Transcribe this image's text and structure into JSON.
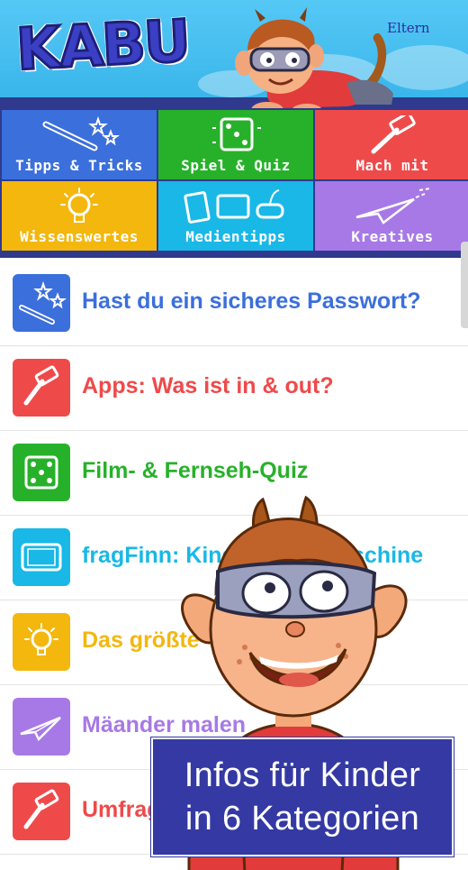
{
  "header": {
    "logo": "KABU",
    "eltern_link": "Eltern"
  },
  "categories": [
    {
      "label": "Tipps & Tricks",
      "icon": "magic-wand-icon",
      "color": "#3b6fdc"
    },
    {
      "label": "Spiel & Quiz",
      "icon": "dice-icon",
      "color": "#27b12a"
    },
    {
      "label": "Mach mit",
      "icon": "hammer-icon",
      "color": "#ef4a4a"
    },
    {
      "label": "Wissenswertes",
      "icon": "lightbulb-icon",
      "color": "#f3b70e"
    },
    {
      "label": "Medientipps",
      "icon": "media-devices-icon",
      "color": "#19b8e6"
    },
    {
      "label": "Kreatives",
      "icon": "paper-plane-icon",
      "color": "#a779e6"
    }
  ],
  "list": {
    "items": [
      {
        "title": "Hast du ein sicheres Passwort?",
        "icon": "magic-wand-icon",
        "color": "#3b6fdc"
      },
      {
        "title": "Apps: Was ist in & out?",
        "icon": "hammer-icon",
        "color": "#ef4a4a"
      },
      {
        "title": "Film- & Fernseh-Quiz",
        "icon": "dice-icon",
        "color": "#27b12a"
      },
      {
        "title": "fragFinn: Kinder-Suchmaschine",
        "icon": "tablet-icon",
        "color": "#19b8e6"
      },
      {
        "title": "Das größte Tier der Welt",
        "icon": "lightbulb-icon",
        "color": "#f3b70e"
      },
      {
        "title": "Mäander malen",
        "icon": "paper-plane-icon",
        "color": "#a779e6"
      },
      {
        "title": "Umfrage",
        "icon": "hammer-icon",
        "color": "#ef4a4a"
      }
    ]
  },
  "promo": {
    "line1": "Infos für Kinder",
    "line2": "in 6 Kategorien"
  }
}
